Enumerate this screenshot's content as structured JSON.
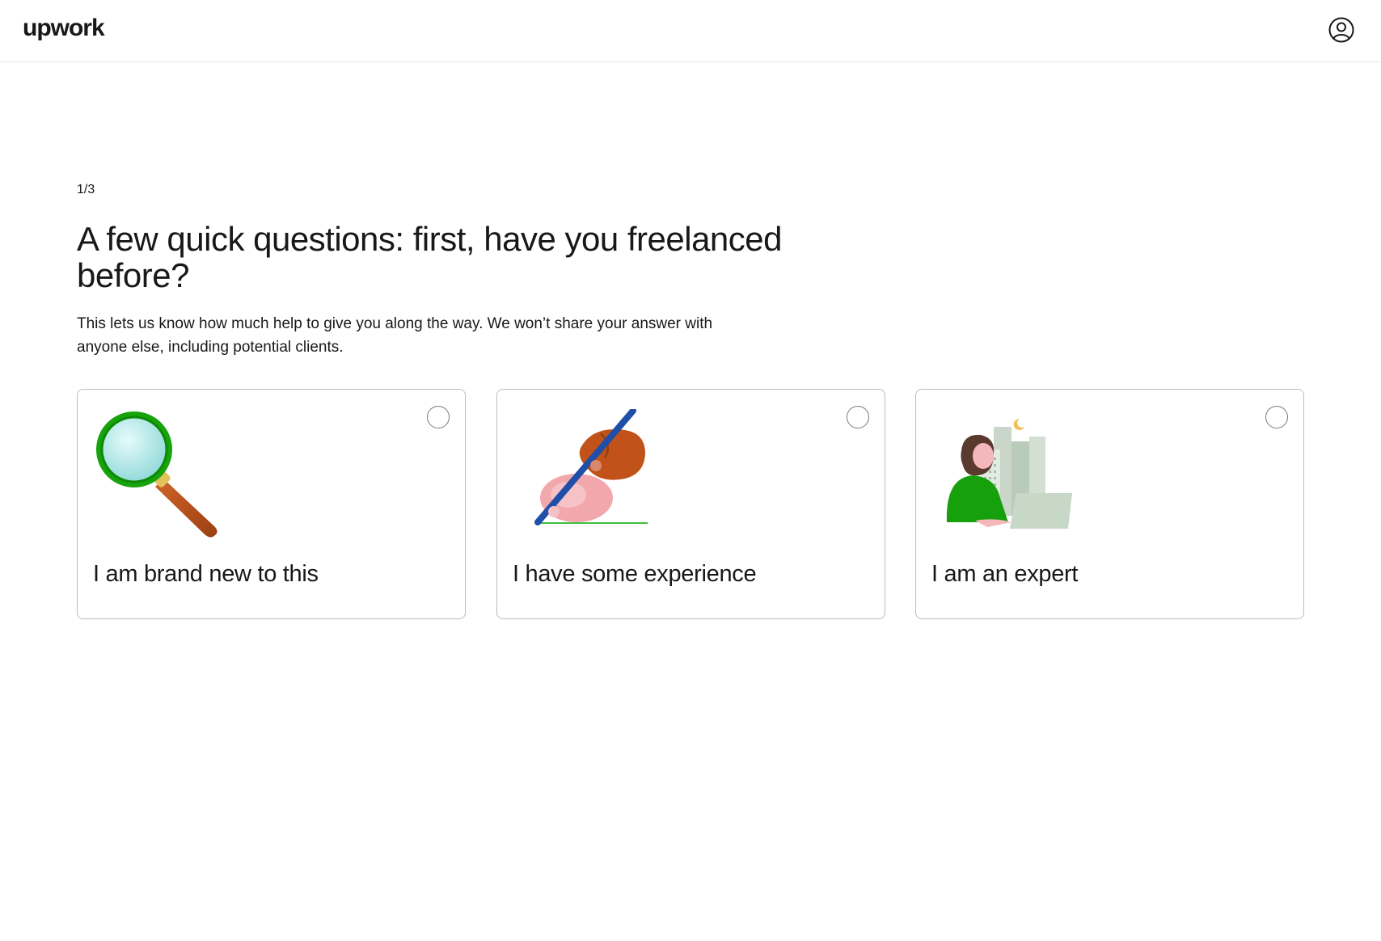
{
  "header": {
    "logo_text": "upwork",
    "account_icon": "user-circle-icon"
  },
  "main": {
    "step": "1/3",
    "title": "A few quick questions: first, have you freelanced before?",
    "subtitle": "This lets us know how much help to give you along the way. We won’t share your answer with anyone else, including potential clients."
  },
  "options": [
    {
      "label": "I am brand new to this",
      "icon": "magnifying-glass-icon",
      "selected": false
    },
    {
      "label": "I have some experience",
      "icon": "hands-writing-icon",
      "selected": false
    },
    {
      "label": "I am an expert",
      "icon": "woman-laptop-city-icon",
      "selected": false
    }
  ],
  "colors": {
    "brand_green": "#14a800",
    "text": "#181818",
    "border": "#bdbdbd"
  }
}
